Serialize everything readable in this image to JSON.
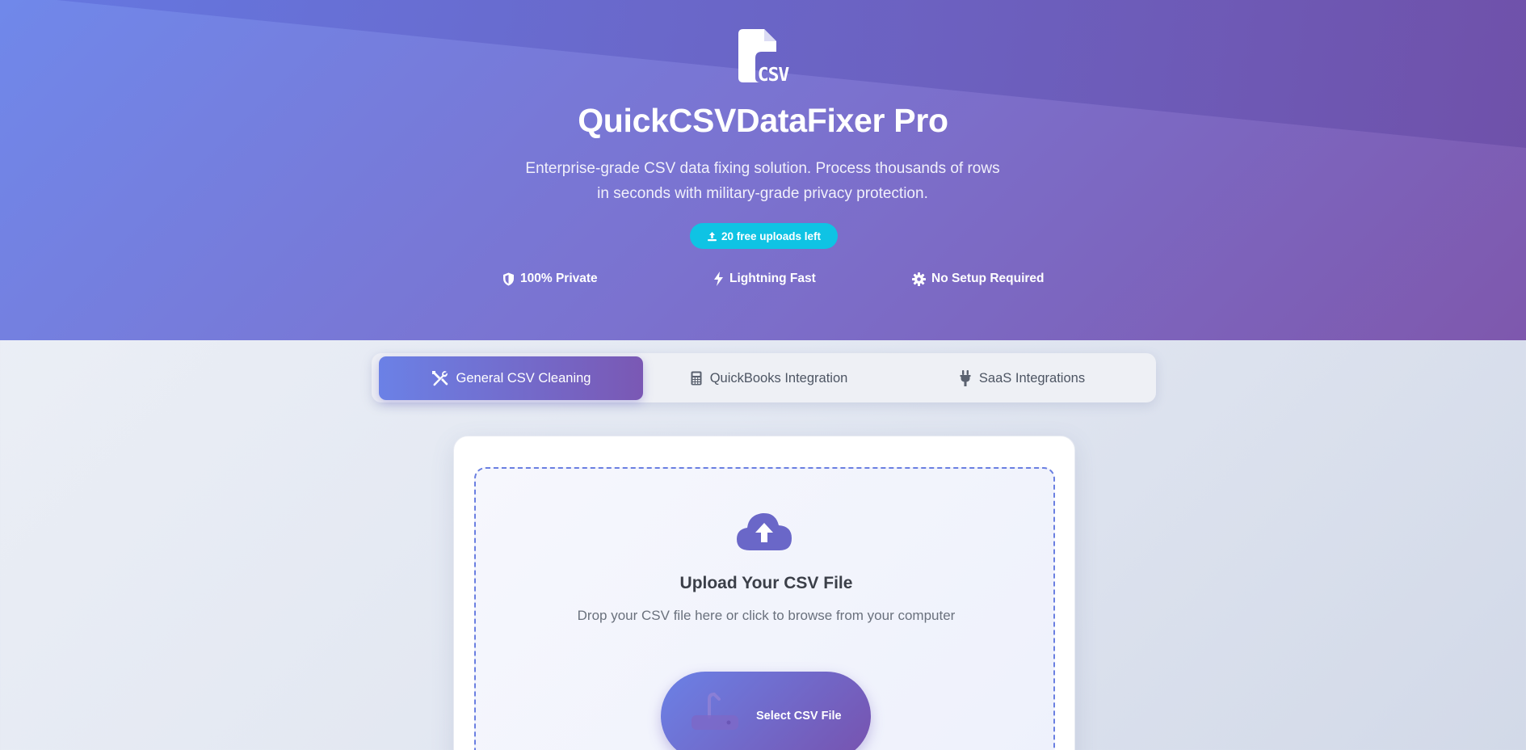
{
  "hero": {
    "logo_text": "CSV",
    "title": "QuickCSVDataFixer Pro",
    "tagline_line1": "Enterprise-grade CSV data fixing solution. Process thousands of rows",
    "tagline_line2": "in seconds with military-grade privacy protection.",
    "uploads_badge": "20 free uploads left",
    "features": [
      {
        "label": "100% Private",
        "icon": "shield-icon"
      },
      {
        "label": "Lightning Fast",
        "icon": "bolt-icon"
      },
      {
        "label": "No Setup Required",
        "icon": "gear-icon"
      }
    ]
  },
  "tabs": [
    {
      "label": "General CSV Cleaning",
      "icon": "tools-icon",
      "active": true
    },
    {
      "label": "QuickBooks Integration",
      "icon": "calculator-icon",
      "active": false
    },
    {
      "label": "SaaS Integrations",
      "icon": "plug-icon",
      "active": false
    }
  ],
  "upload": {
    "icon": "cloud-upload-icon",
    "title": "Upload Your CSV File",
    "subtitle": "Drop your CSV file here or click to browse from your computer",
    "button_label": "Select CSV File",
    "button_icon": "file-upload-icon"
  },
  "colors": {
    "hero_start": "#7088ea",
    "hero_end": "#7e58ad",
    "badge": "#0fc3e4",
    "accent": "#6b81e6",
    "accent_end": "#7752ae"
  }
}
